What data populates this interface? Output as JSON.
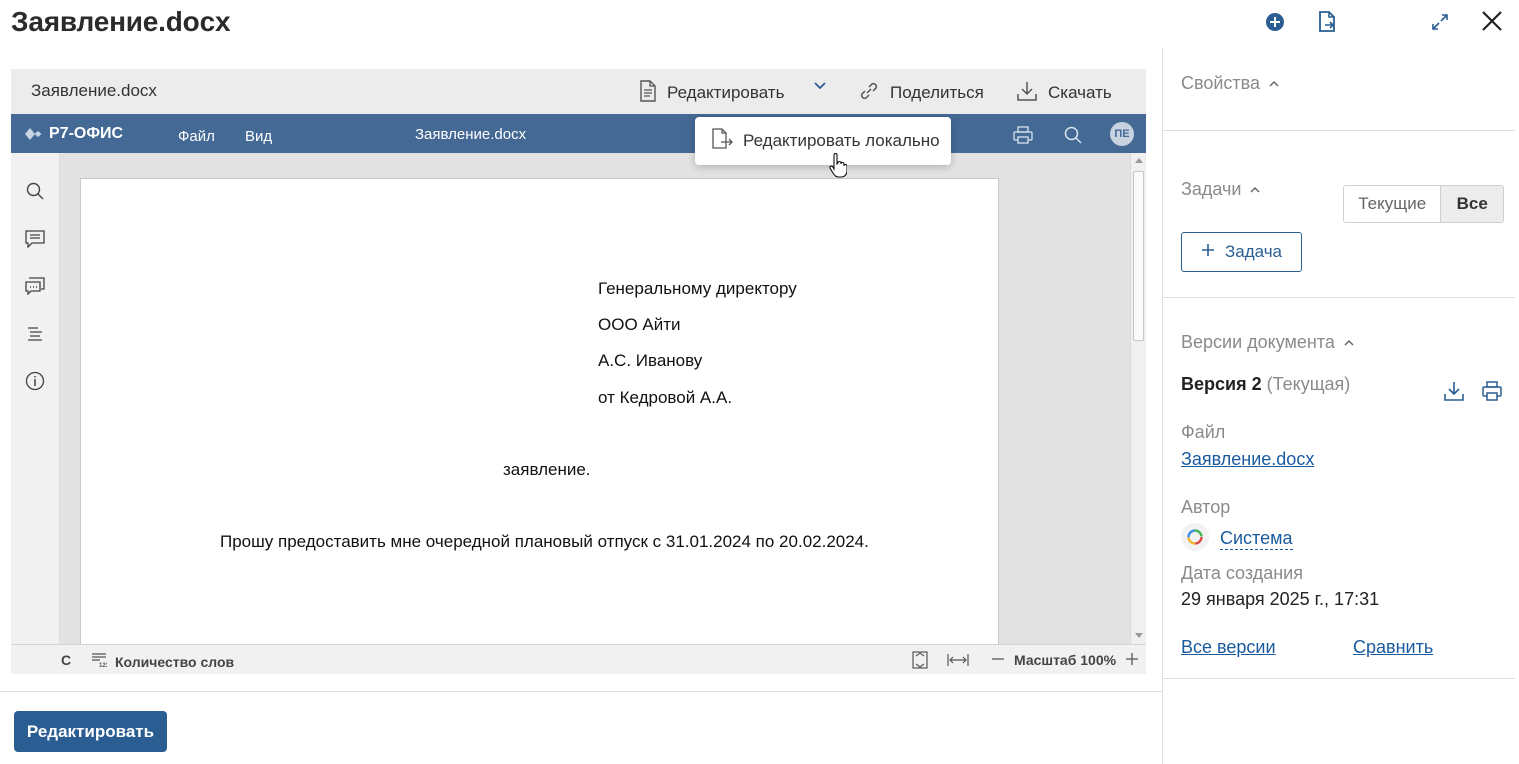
{
  "page": {
    "title": "Заявление.docx"
  },
  "viewer": {
    "filename": "Заявление.docx",
    "edit_label": "Редактировать",
    "share_label": "Поделиться",
    "download_label": "Скачать",
    "dropdown_item": "Редактировать локально"
  },
  "r7": {
    "logo": "Р7-ОФИС",
    "menu_file": "Файл",
    "menu_view": "Вид",
    "docname": "Заявление.docx",
    "avatar": "ПЕ"
  },
  "document": {
    "lines": [
      "Генеральному директору",
      "ООО Айти",
      "А.С. Иванову",
      "от Кедровой А.А.",
      "заявление.",
      "Прошу предоставить мне очередной плановый отпуск с 31.01.2024 по 20.02.2024."
    ]
  },
  "status": {
    "page_indicator": "С",
    "word_count": "Количество слов",
    "zoom": "Масштаб 100%"
  },
  "bottom": {
    "edit_button": "Редактировать"
  },
  "panel": {
    "properties": "Свойства",
    "tasks": "Задачи",
    "tasks_current": "Текущие",
    "tasks_all": "Все",
    "add_task": "Задача",
    "versions": "Версии документа",
    "version_name": "Версия 2",
    "version_status": "(Текущая)",
    "file_label": "Файл",
    "file_link": "Заявление.docx",
    "author_label": "Автор",
    "author_name": "Система",
    "created_label": "Дата создания",
    "created_value": "29 января 2025 г., 17:31",
    "all_versions": "Все версии",
    "compare": "Сравнить"
  },
  "colors": {
    "primary": "#2a5e92",
    "r7_bar": "#446995",
    "link": "#1a5a9e"
  }
}
